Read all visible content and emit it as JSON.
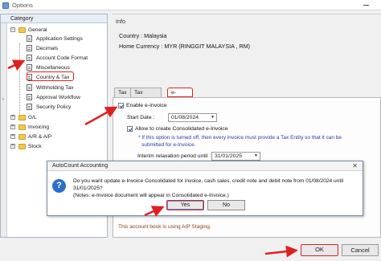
{
  "window": {
    "title": "Options"
  },
  "tree": {
    "header": "Category",
    "general": "General",
    "items": [
      {
        "label": "Application Settings"
      },
      {
        "label": "Decimals"
      },
      {
        "label": "Account Code Format"
      },
      {
        "label": "Miscellaneous"
      },
      {
        "label": "Country & Tax"
      },
      {
        "label": "Withholding Tax"
      },
      {
        "label": "Approval Workflow"
      },
      {
        "label": "Security Policy"
      }
    ],
    "groups": [
      {
        "label": "G/L"
      },
      {
        "label": "Invoicing"
      },
      {
        "label": "A/R & A/P"
      },
      {
        "label": "Stock"
      }
    ]
  },
  "info": {
    "title": "Info",
    "country": "Country : Malaysia",
    "currency": "Home Currency : MYR (RINGGIT MALAYSIA , RM)"
  },
  "tabs": [
    {
      "label": "Tax"
    },
    {
      "label": "Tax Reporting"
    },
    {
      "label": "e-Invoice"
    }
  ],
  "einvoice": {
    "enable_label": "Enable e-Invoice",
    "start_date_label": "Start Date :",
    "start_date_value": "01/08/2024",
    "consolidated_label": "Allow to create Consolidated e-Invoice",
    "note_line1": "* If this option is turned off, then every invoice must provide a Tax Entity so that it can be",
    "note_line2": "submitted for e-Invoice.",
    "interim_label": "Interim relaxation period until :",
    "interim_value": "31/01/2025",
    "staging_note": "This account book is using AIP Staging."
  },
  "dialog": {
    "title": "AutoCount Accounting",
    "message_line1": "Do you want update e-Invoice Consolidated for invoice, cash sales, credit note and debit note from 01/08/2024 until 31/01/2025?",
    "message_line2": "(Notes: e-Invoice document will appear in Consolidated e-Invoice.)",
    "yes_label": "Yes",
    "no_label": "No"
  },
  "footer": {
    "ok_label": "OK",
    "cancel_label": "Cancel"
  },
  "colors": {
    "annotation": "#e02020",
    "note_text": "#2a3aa8",
    "staging_text": "#8b4513"
  }
}
